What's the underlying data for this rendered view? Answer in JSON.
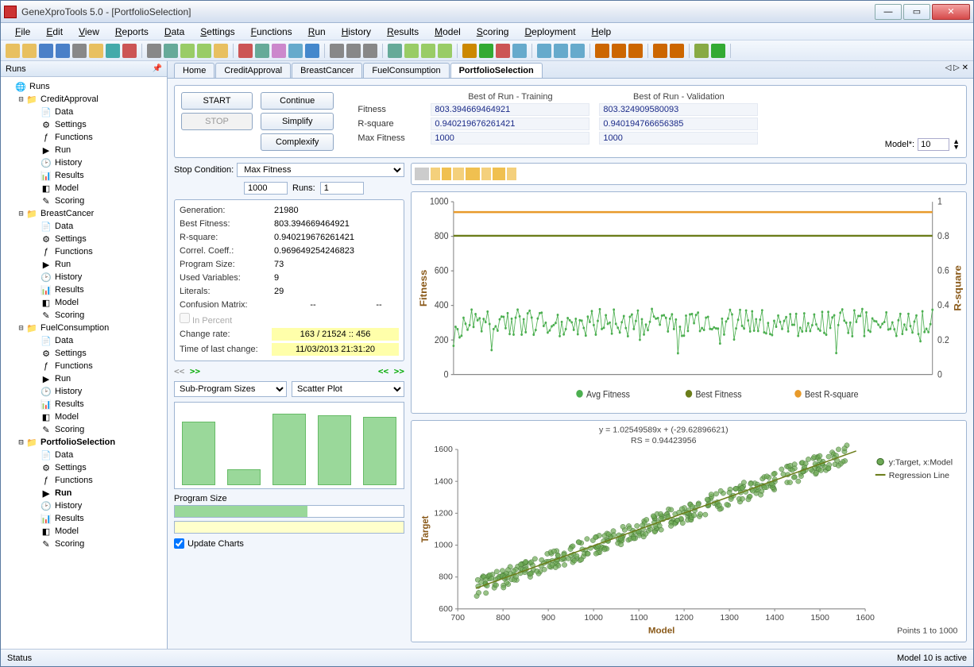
{
  "window": {
    "title": "GeneXproTools 5.0 - [PortfolioSelection]"
  },
  "menu": [
    "File",
    "Edit",
    "View",
    "Reports",
    "Data",
    "Settings",
    "Functions",
    "Run",
    "History",
    "Results",
    "Model",
    "Scoring",
    "Deployment",
    "Help"
  ],
  "sidebar": {
    "title": "Runs",
    "root": "Runs",
    "projects": [
      {
        "name": "CreditApproval",
        "bold": false,
        "children": [
          "Data",
          "Settings",
          "Functions",
          "Run",
          "History",
          "Results",
          "Model",
          "Scoring"
        ]
      },
      {
        "name": "BreastCancer",
        "bold": false,
        "children": [
          "Data",
          "Settings",
          "Functions",
          "Run",
          "History",
          "Results",
          "Model",
          "Scoring"
        ]
      },
      {
        "name": "FuelConsumption",
        "bold": false,
        "children": [
          "Data",
          "Settings",
          "Functions",
          "Run",
          "History",
          "Results",
          "Model",
          "Scoring"
        ]
      },
      {
        "name": "PortfolioSelection",
        "bold": true,
        "children": [
          "Data",
          "Settings",
          "Functions",
          "Run",
          "History",
          "Results",
          "Model",
          "Scoring"
        ]
      }
    ]
  },
  "tabs": [
    "Home",
    "CreditApproval",
    "BreastCancer",
    "FuelConsumption",
    "PortfolioSelection"
  ],
  "active_tab": "PortfolioSelection",
  "ctrl": {
    "start": "START",
    "stop": "STOP",
    "continue": "Continue",
    "simplify": "Simplify",
    "complexify": "Complexify"
  },
  "best": {
    "head_train": "Best of Run - Training",
    "head_valid": "Best of Run - Validation",
    "rows": [
      {
        "lbl": "Fitness",
        "t": "803.394669464921",
        "v": "803.324909580093"
      },
      {
        "lbl": "R-square",
        "t": "0.940219676261421",
        "v": "0.940194766656385"
      },
      {
        "lbl": "Max Fitness",
        "t": "1000",
        "v": "1000"
      }
    ]
  },
  "model_label": "Model*:",
  "model_value": "10",
  "stopcond": {
    "label": "Stop Condition:",
    "value": "Max Fitness",
    "num": "1000",
    "runs_lbl": "Runs:",
    "runs": "1"
  },
  "stats": {
    "generation": {
      "lbl": "Generation:",
      "v": "21980"
    },
    "bestfit": {
      "lbl": "Best Fitness:",
      "v": "803.394669464921"
    },
    "rsq": {
      "lbl": "R-square:",
      "v": "0.940219676261421"
    },
    "corr": {
      "lbl": "Correl. Coeff.:",
      "v": "0.969649254246823"
    },
    "psize": {
      "lbl": "Program Size:",
      "v": "73"
    },
    "uvars": {
      "lbl": "Used Variables:",
      "v": "9"
    },
    "lits": {
      "lbl": "Literals:",
      "v": "29"
    },
    "conf": {
      "lbl": "Confusion Matrix:",
      "v1": "--",
      "v2": "--"
    },
    "inpct": "In Percent",
    "chrate": {
      "lbl": "Change rate:",
      "v": "163 / 21524 :: 456"
    },
    "tlc": {
      "lbl": "Time of last change:",
      "v": "11/03/2013 21:31:20"
    }
  },
  "subchart": {
    "sel1": "Sub-Program Sizes",
    "sel2": "Scatter Plot",
    "label": "Program Size"
  },
  "update_charts": "Update Charts",
  "chart_data": {
    "top_chart": {
      "type": "line",
      "ylabel_left": "Fitness",
      "ylabel_right": "R-square",
      "y_left_ticks": [
        0,
        200,
        400,
        600,
        800,
        1000
      ],
      "y_right_ticks": [
        0,
        0.2,
        0.4,
        0.6,
        0.8,
        1
      ],
      "series": [
        {
          "name": "Avg Fitness",
          "color": "#4caf50",
          "approx_mean": 300,
          "approx_range": [
            140,
            480
          ],
          "style": "noisy"
        },
        {
          "name": "Best Fitness",
          "color": "#6b7d1a",
          "constant": 803.39
        },
        {
          "name": "Best R-square",
          "color": "#e89a2a",
          "constant": 0.9402,
          "axis": "right"
        }
      ],
      "legend": [
        "Avg Fitness",
        "Best Fitness",
        "Best R-square"
      ]
    },
    "bottom_chart": {
      "type": "scatter",
      "title": "y = 1.02549589x + (-29.62896621)",
      "subtitle": "RS = 0.94423956",
      "xlabel": "Model",
      "ylabel": "Target",
      "x_ticks": [
        700,
        800,
        900,
        1000,
        1100,
        1200,
        1300,
        1400,
        1500,
        1600
      ],
      "y_ticks": [
        600,
        800,
        1000,
        1200,
        1400,
        1600
      ],
      "regression": {
        "slope": 1.02549589,
        "intercept": -29.62896621
      },
      "legend": [
        "y:Target, x:Model",
        "Regression Line"
      ],
      "footer": "Points 1 to 1000",
      "n_points": 1000,
      "x_range": [
        740,
        1580
      ],
      "y_range": [
        680,
        1560
      ]
    },
    "mini_bars": {
      "type": "bar",
      "values": [
        80,
        20,
        90,
        88,
        86
      ],
      "label": "Program Size"
    },
    "progress_pct": 58
  },
  "status": {
    "left": "Status",
    "right": "Model 10 is active"
  }
}
